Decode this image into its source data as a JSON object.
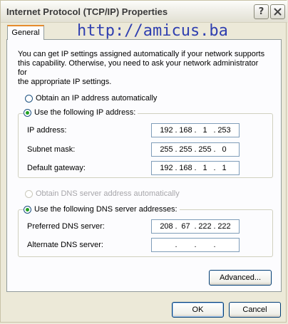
{
  "window": {
    "title": "Internet Protocol (TCP/IP) Properties",
    "help_glyph": "?"
  },
  "tabs": [
    {
      "label": "General",
      "active": true
    }
  ],
  "watermark": "http://amicus.ba",
  "intro_text": "You can get IP settings assigned automatically if your network supports\nthis capability. Otherwise, you need to ask your network administrator for\nthe appropriate IP settings.",
  "ip_settings": {
    "auto_label": "Obtain an IP address automatically",
    "auto_selected": false,
    "manual_label": "Use the following IP address:",
    "manual_selected": true,
    "fields": [
      {
        "label": "IP address:",
        "octets": [
          "192",
          "168",
          "1",
          "253"
        ]
      },
      {
        "label": "Subnet mask:",
        "octets": [
          "255",
          "255",
          "255",
          "0"
        ]
      },
      {
        "label": "Default gateway:",
        "octets": [
          "192",
          "168",
          "1",
          "1"
        ]
      }
    ]
  },
  "dns_settings": {
    "auto_label": "Obtain DNS server address automatically",
    "auto_selected": false,
    "auto_disabled": true,
    "manual_label": "Use the following DNS server addresses:",
    "manual_selected": true,
    "fields": [
      {
        "label": "Preferred DNS server:",
        "octets": [
          "208",
          "67",
          "222",
          "222"
        ]
      },
      {
        "label": "Alternate DNS server:",
        "octets": [
          "",
          "",
          "",
          ""
        ]
      }
    ]
  },
  "buttons": {
    "advanced": "Advanced...",
    "ok": "OK",
    "cancel": "Cancel"
  },
  "colors": {
    "accent_tab": "#e68b2c",
    "radio_dot": "#21a121",
    "watermark": "#2f3fb0"
  }
}
